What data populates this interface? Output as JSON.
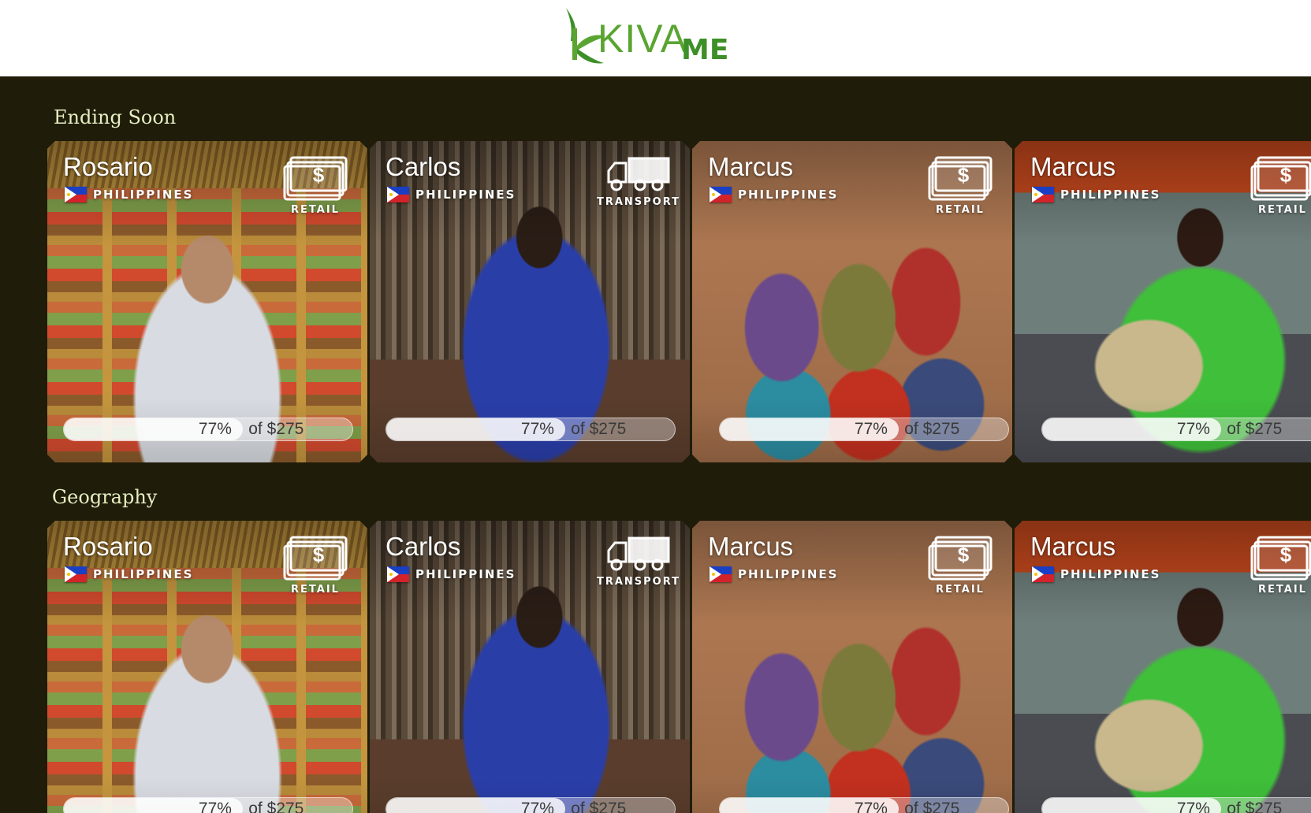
{
  "header": {
    "logo_primary": "KIVA",
    "logo_secondary": "ME",
    "brand_color": "#5aa531"
  },
  "sections": [
    {
      "title": "Ending Soon",
      "loans": [
        {
          "name": "Rosario",
          "country": "PHILIPPINES",
          "sector": "RETAIL",
          "sector_icon": "money-icon",
          "percent_label": "77%",
          "goal_label": "of $275",
          "funded_fraction": 0.77
        },
        {
          "name": "Carlos",
          "country": "PHILIPPINES",
          "sector": "TRANSPORT",
          "sector_icon": "truck-icon",
          "percent_label": "77%",
          "goal_label": "of $275",
          "funded_fraction": 0.77
        },
        {
          "name": "Marcus",
          "country": "PHILIPPINES",
          "sector": "RETAIL",
          "sector_icon": "money-icon",
          "percent_label": "77%",
          "goal_label": "of $275",
          "funded_fraction": 0.77
        },
        {
          "name": "Marcus",
          "country": "PHILIPPINES",
          "sector": "RETAIL",
          "sector_icon": "money-icon",
          "percent_label": "77%",
          "goal_label": "of $275",
          "funded_fraction": 0.77
        }
      ]
    },
    {
      "title": "Geography",
      "loans": [
        {
          "name": "Rosario",
          "country": "PHILIPPINES",
          "sector": "RETAIL",
          "sector_icon": "money-icon",
          "percent_label": "77%",
          "goal_label": "of $275",
          "funded_fraction": 0.77
        },
        {
          "name": "Carlos",
          "country": "PHILIPPINES",
          "sector": "TRANSPORT",
          "sector_icon": "truck-icon",
          "percent_label": "77%",
          "goal_label": "of $275",
          "funded_fraction": 0.77
        },
        {
          "name": "Marcus",
          "country": "PHILIPPINES",
          "sector": "RETAIL",
          "sector_icon": "money-icon",
          "percent_label": "77%",
          "goal_label": "of $275",
          "funded_fraction": 0.77
        },
        {
          "name": "Marcus",
          "country": "PHILIPPINES",
          "sector": "RETAIL",
          "sector_icon": "money-icon",
          "percent_label": "77%",
          "goal_label": "of $275",
          "funded_fraction": 0.77
        }
      ]
    }
  ]
}
